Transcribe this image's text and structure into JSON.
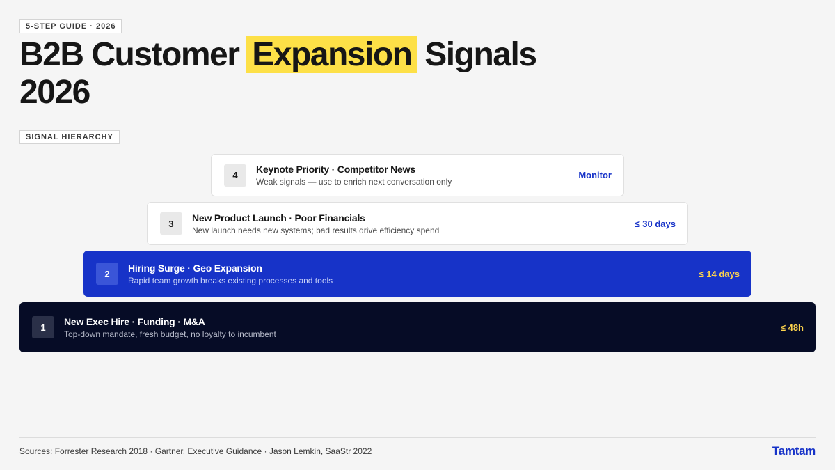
{
  "eyebrow": "5-STEP GUIDE · 2026",
  "title": {
    "before": "B2B Customer ",
    "highlight": "Expansion",
    "after": " Signals 2026"
  },
  "section_label": "SIGNAL HIERARCHY",
  "tiers": [
    {
      "rank": "4",
      "heading": "Keynote Priority · Competitor News",
      "description": "Weak signals — use to enrich next conversation only",
      "timeframe": "Monitor"
    },
    {
      "rank": "3",
      "heading": "New Product Launch · Poor Financials",
      "description": "New launch needs new systems; bad results drive efficiency spend",
      "timeframe": "≤ 30 days"
    },
    {
      "rank": "2",
      "heading": "Hiring Surge · Geo Expansion",
      "description": "Rapid team growth breaks existing processes and tools",
      "timeframe": "≤ 14 days"
    },
    {
      "rank": "1",
      "heading": "New Exec Hire · Funding · M&A",
      "description": "Top-down mandate, fresh budget, no loyalty to incumbent",
      "timeframe": "≤ 48h"
    }
  ],
  "footer": {
    "sources": "Sources: Forrester Research 2018 · Gartner, Executive Guidance · Jason Lemkin, SaaStr 2022",
    "brand": "Tamtam"
  },
  "colors": {
    "accent_blue": "#1733c8",
    "highlight_yellow": "#fde047",
    "navy": "#060c26",
    "timeframe_gold": "#fcd34d"
  }
}
